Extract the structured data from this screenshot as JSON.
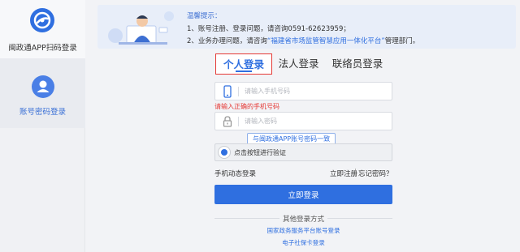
{
  "sidebar": {
    "items": [
      {
        "label": "闽政通APP扫码登录",
        "icon": "qr-app-logo-icon"
      },
      {
        "label": "账号密码登录",
        "icon": "user-icon"
      }
    ]
  },
  "notice": {
    "title": "温馨提示：",
    "line1": "1、账号注册、登录问题，请咨询0591-62623959；",
    "line2_prefix": "2、业务办理问题，请咨询",
    "line2_link": "“福建省市场监管智慧应用一体化平台”",
    "line2_suffix": "管理部门。"
  },
  "tabs": [
    {
      "label": "个人登录",
      "active": true
    },
    {
      "label": "法人登录",
      "active": false
    },
    {
      "label": "联络员登录",
      "active": false
    }
  ],
  "form": {
    "phone_placeholder": "请输入手机号码",
    "phone_error": "请输入正确的手机号码",
    "password_placeholder": "请输入密码",
    "tooltip": "与闽政通APP账号密码一致",
    "verify_text": "点击按钮进行验证",
    "sms_login": "手机动态登录",
    "register": "立即注册",
    "separator": "|",
    "forgot": "忘记密码？",
    "submit": "立即登录"
  },
  "other": {
    "title": "其他登录方式",
    "links": [
      "国家政务服务平台账号登录",
      "电子社保卡登录"
    ]
  },
  "colors": {
    "primary": "#2f6fe0",
    "error": "#e53935",
    "active_tab_border": "#e53935"
  }
}
